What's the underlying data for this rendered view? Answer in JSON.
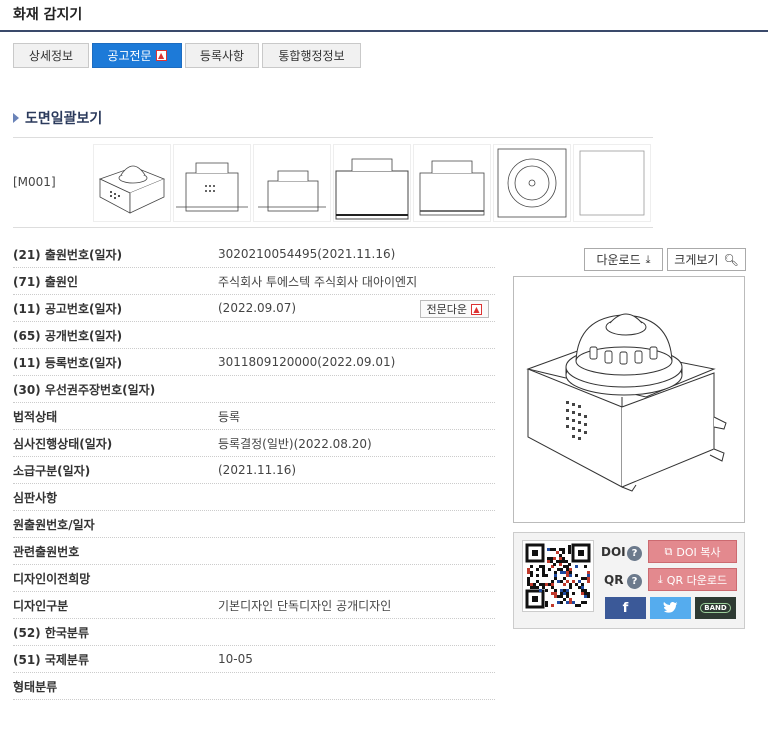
{
  "page_title": "화재 감지기",
  "tabs": [
    {
      "label": "상세정보",
      "active": false
    },
    {
      "label": "공고전문",
      "active": true
    },
    {
      "label": "등록사항",
      "active": false
    },
    {
      "label": "통합행정정보",
      "active": false
    }
  ],
  "section_title": "도면일괄보기",
  "drawing_label": "[M001]",
  "details": [
    {
      "key": "(21) 출원번호(일자)",
      "value": "3020210054495(2021.11.16)"
    },
    {
      "key": "(71) 출원인",
      "value": "주식회사 투에스텍 주식회사 대아이엔지"
    },
    {
      "key": "(11) 공고번호(일자)",
      "value": "(2022.09.07)"
    },
    {
      "key": "(65) 공개번호(일자)",
      "value": ""
    },
    {
      "key": "(11) 등록번호(일자)",
      "value": "3011809120000(2022.09.01)"
    },
    {
      "key": "(30) 우선권주장번호(일자)",
      "value": ""
    },
    {
      "key": "법적상태",
      "value": "등록"
    },
    {
      "key": "심사진행상태(일자)",
      "value": "등록결정(일반)(2022.08.20)"
    },
    {
      "key": "소급구분(일자)",
      "value": "(2021.11.16)"
    },
    {
      "key": "심판사항",
      "value": ""
    },
    {
      "key": "원출원번호/일자",
      "value": ""
    },
    {
      "key": "관련출원번호",
      "value": ""
    },
    {
      "key": "디자인이전희망",
      "value": ""
    },
    {
      "key": "디자인구분",
      "value": "기본디자인 단독디자인 공개디자인"
    },
    {
      "key": "(52) 한국분류",
      "value": ""
    },
    {
      "key": "(51) 국제분류",
      "value": "10-05"
    },
    {
      "key": "형태분류",
      "value": ""
    }
  ],
  "full_text_download_label": "전문다운",
  "download_label": "다운로드",
  "zoom_label": "크게보기",
  "share": {
    "doi_label": "DOI",
    "qr_label": "QR",
    "doi_copy_label": "DOI 복사",
    "qr_download_label": "QR 다운로드",
    "facebook": "f",
    "band": "BAND"
  },
  "colors": {
    "active_tab": "#1d7ad8",
    "title_line": "#3a4a6b",
    "pink_button": "#e3898e",
    "facebook": "#3b5998",
    "twitter": "#55acee",
    "band": "#2e3a33"
  }
}
